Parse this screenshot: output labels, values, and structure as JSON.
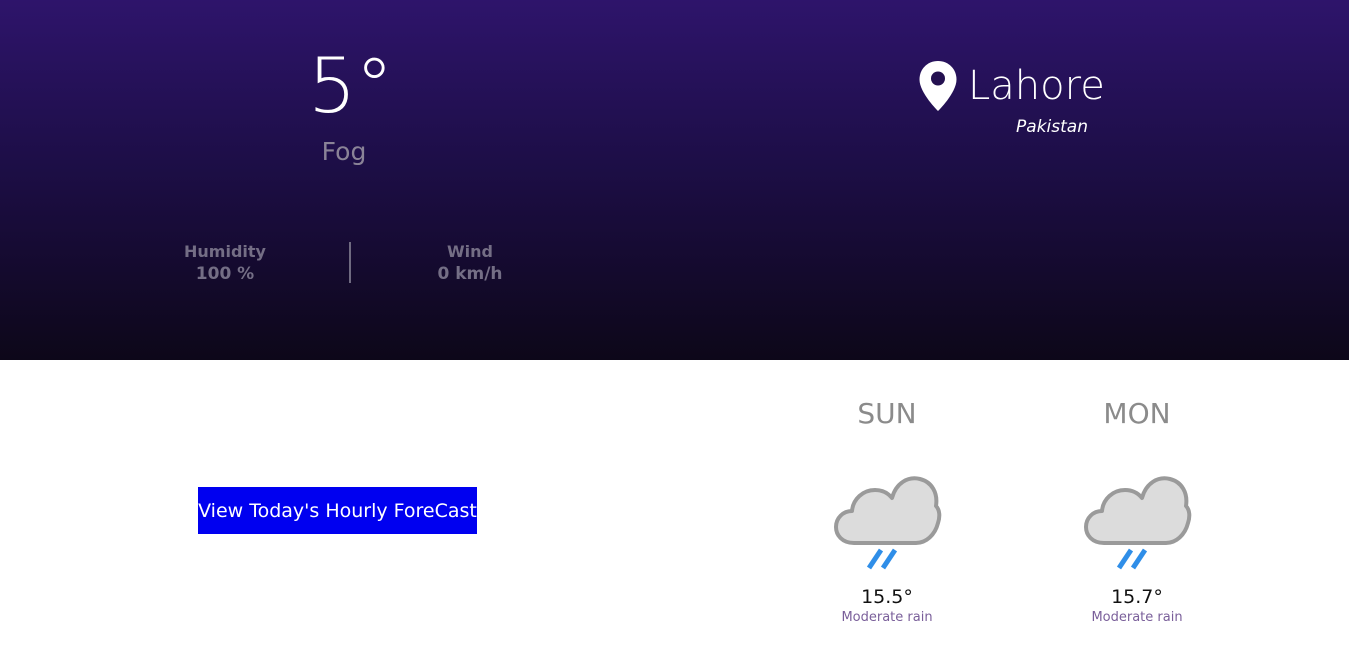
{
  "current": {
    "temperature": "5°",
    "condition": "Fog",
    "humidity": {
      "label": "Humidity",
      "value": "100 %"
    },
    "wind": {
      "label": "Wind",
      "value": "0 km/h"
    }
  },
  "location": {
    "icon": "map-pin-icon",
    "city": "Lahore",
    "country": "Pakistan"
  },
  "actions": {
    "hourly_forecast_label": "View Today's Hourly ForeCast"
  },
  "forecast": [
    {
      "day": "SUN",
      "icon": "rain-cloud-icon",
      "temperature": "15.5°",
      "description": "Moderate rain"
    },
    {
      "day": "MON",
      "icon": "rain-cloud-icon",
      "temperature": "15.7°",
      "description": "Moderate rain"
    }
  ],
  "colors": {
    "hero_top": "#2e146b",
    "hero_bottom": "#0d0719",
    "button_bg": "#0000f0",
    "rain_streak": "#2f8ee8"
  }
}
